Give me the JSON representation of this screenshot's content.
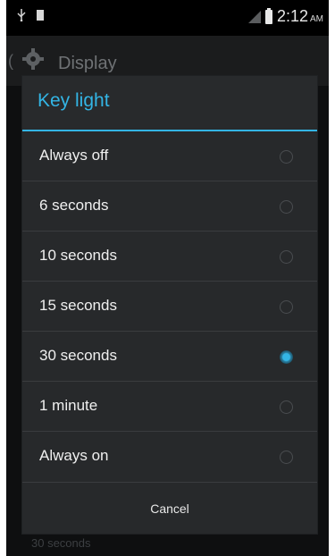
{
  "status_bar": {
    "time": "2:12",
    "ampm": "AM",
    "icons": [
      "usb-icon",
      "sdcard-icon",
      "signal-icon",
      "battery-icon"
    ]
  },
  "background": {
    "action_bar_title": "Display",
    "back_glyph": "(",
    "list_subtitle": "30 seconds"
  },
  "dialog": {
    "title": "Key light",
    "accent_color": "#33b5e5",
    "options": [
      {
        "label": "Always off",
        "checked": false
      },
      {
        "label": "6 seconds",
        "checked": false
      },
      {
        "label": "10 seconds",
        "checked": false
      },
      {
        "label": "15 seconds",
        "checked": false
      },
      {
        "label": "30 seconds",
        "checked": true
      },
      {
        "label": "1 minute",
        "checked": false
      },
      {
        "label": "Always on",
        "checked": false
      }
    ],
    "cancel_label": "Cancel"
  }
}
